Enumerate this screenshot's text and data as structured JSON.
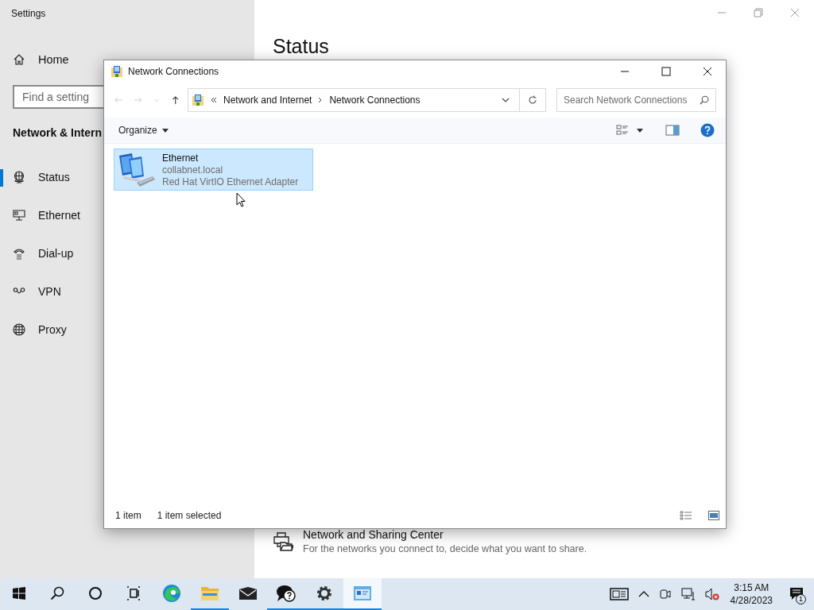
{
  "settings": {
    "title": "Settings",
    "home": "Home",
    "search": {
      "placeholder": "Find a setting"
    },
    "section": "Network & Intern",
    "nav": [
      {
        "kind": "status",
        "label": "Status",
        "selected": true
      },
      {
        "kind": "ethernet",
        "label": "Ethernet",
        "selected": false
      },
      {
        "kind": "dialup",
        "label": "Dial-up",
        "selected": false
      },
      {
        "kind": "vpn",
        "label": "VPN",
        "selected": false
      },
      {
        "kind": "proxy",
        "label": "Proxy",
        "selected": false
      }
    ],
    "heading": "Status",
    "links": [
      {
        "title": "Network and Sharing Center",
        "description": "For the networks you connect to, decide what you want to share."
      }
    ]
  },
  "explorer": {
    "title": "Network Connections",
    "breadcrumb": [
      "Network and Internet",
      "Network Connections"
    ],
    "search": {
      "placeholder": "Search Network Connections"
    },
    "organize": "Organize",
    "items": [
      {
        "name": "Ethernet",
        "network": "collabnet.local",
        "device": "Red Hat VirtIO Ethernet Adapter",
        "selected": true
      }
    ],
    "status": [
      "1 item",
      "1 item selected"
    ]
  },
  "taskbar": {
    "apps": [
      {
        "kind": "start",
        "running": false,
        "selected": false
      },
      {
        "kind": "search",
        "running": false,
        "selected": false
      },
      {
        "kind": "cortana",
        "running": false,
        "selected": false
      },
      {
        "kind": "taskview",
        "running": false,
        "selected": false
      },
      {
        "kind": "edge",
        "running": false,
        "selected": false
      },
      {
        "kind": "explorer",
        "running": true,
        "selected": false
      },
      {
        "kind": "mail",
        "running": false,
        "selected": false
      },
      {
        "kind": "feedback",
        "running": true,
        "selected": false
      },
      {
        "kind": "settings",
        "running": true,
        "selected": false
      },
      {
        "kind": "network",
        "running": true,
        "selected": true
      }
    ],
    "time": "3:15 AM",
    "date": "4/28/2023",
    "notifications": "1"
  }
}
